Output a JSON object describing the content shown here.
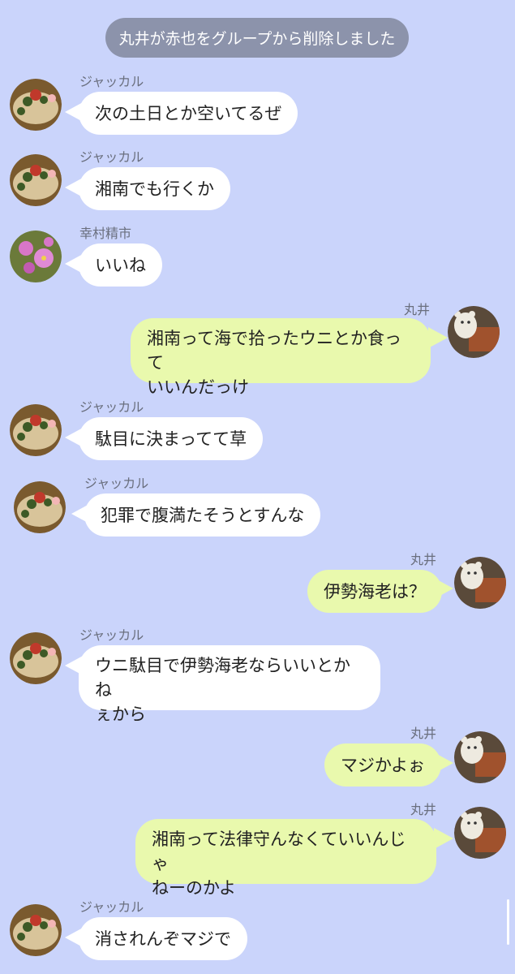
{
  "system_message": "丸井が赤也をグループから削除しました",
  "messages": [
    {
      "sender": "ジャッカル",
      "text": "次の土日とか空いてるぜ",
      "avatar": "food-bowl"
    },
    {
      "sender": "ジャッカル",
      "text": "湘南でも行くか",
      "avatar": "food-bowl"
    },
    {
      "sender": "幸村精市",
      "text": "いいね",
      "avatar": "pink-flowers"
    },
    {
      "sender": "丸井",
      "text": "湘南って海で拾ったウニとか食って\nいいんだっけ",
      "avatar": "white-cat"
    },
    {
      "sender": "ジャッカル",
      "text": "駄目に決まってて草",
      "avatar": "food-bowl"
    },
    {
      "sender": "ジャッカル",
      "text": "犯罪で腹満たそうとすんな",
      "avatar": "food-bowl"
    },
    {
      "sender": "丸井",
      "text": "伊勢海老は？",
      "avatar": "white-cat"
    },
    {
      "sender": "ジャッカル",
      "text": "ウニ駄目で伊勢海老ならいいとかね\nぇから",
      "avatar": "food-bowl"
    },
    {
      "sender": "丸井",
      "text": "マジかよぉ",
      "avatar": "white-cat"
    },
    {
      "sender": "丸井",
      "text": "湘南って法律守んなくていいんじゃ\nねーのかよ",
      "avatar": "white-cat"
    },
    {
      "sender": "ジャッカル",
      "text": "消されんぞマジで",
      "avatar": "food-bowl"
    }
  ]
}
